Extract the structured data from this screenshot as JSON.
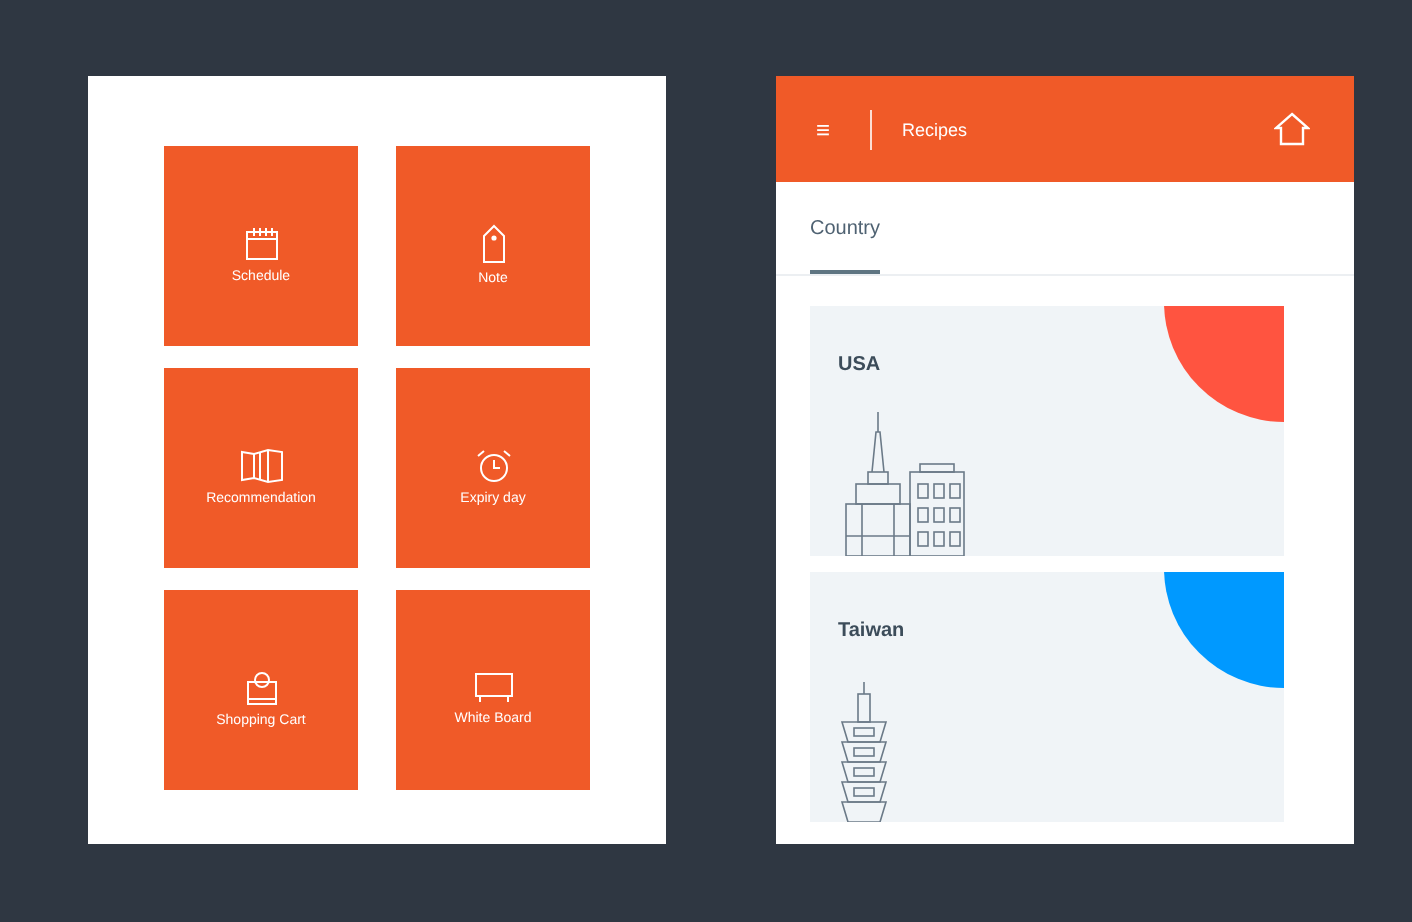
{
  "menu_tiles": [
    {
      "label": "Schedule",
      "kind": "calendar"
    },
    {
      "label": "Note",
      "kind": "tag"
    },
    {
      "label": "Recommendation",
      "kind": "map"
    },
    {
      "label": "Expiry day",
      "kind": "alarm"
    },
    {
      "label": "Shopping Cart",
      "kind": "bag"
    },
    {
      "label": "White Board",
      "kind": "board"
    }
  ],
  "app_bar": {
    "menu_icon": "≡",
    "title": "Recipes"
  },
  "tabs": [
    {
      "label": "Country",
      "selected": true
    }
  ],
  "cards": [
    {
      "title": "USA",
      "color": "#ff5440",
      "kind": "skyline"
    },
    {
      "title": "Taiwan",
      "color": "#0099ff",
      "kind": "tower"
    }
  ]
}
